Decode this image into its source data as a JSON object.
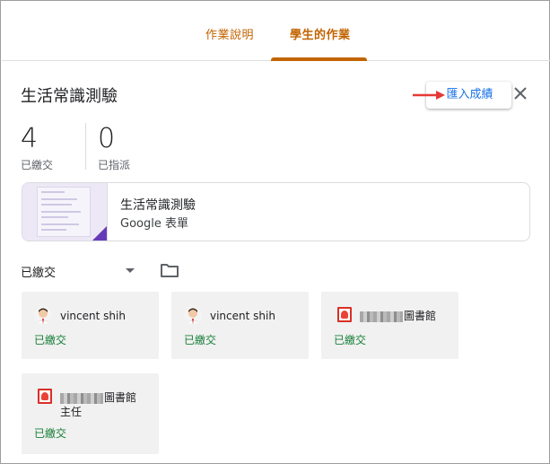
{
  "tabs": [
    {
      "label": "作業說明"
    },
    {
      "label": "學生的作業"
    }
  ],
  "header": {
    "title": "生活常識測驗",
    "import_label": "匯入成績"
  },
  "stats": [
    {
      "value": "4",
      "label": "已繳交"
    },
    {
      "value": "0",
      "label": "已指派"
    }
  ],
  "attachment": {
    "title": "生活常識測驗",
    "subtitle": "Google 表單"
  },
  "filter": {
    "selected": "已繳交"
  },
  "students": [
    {
      "name": "vincent shih",
      "status": "已繳交",
      "avatar": "person-avatar"
    },
    {
      "name": "vincent shih",
      "status": "已繳交",
      "avatar": "person-avatar"
    },
    {
      "name": "圖書館",
      "status": "已繳交",
      "avatar": "library-icon"
    },
    {
      "name": "圖書館",
      "name_line2": "主任",
      "status": "已繳交",
      "avatar": "library-icon"
    }
  ],
  "colors": {
    "accent": "#c26401",
    "link": "#1a73e8",
    "submitted": "#188038",
    "card_bg": "#f1f1f1",
    "form_purple": "#673ab7",
    "arrow_red": "#e53935"
  }
}
